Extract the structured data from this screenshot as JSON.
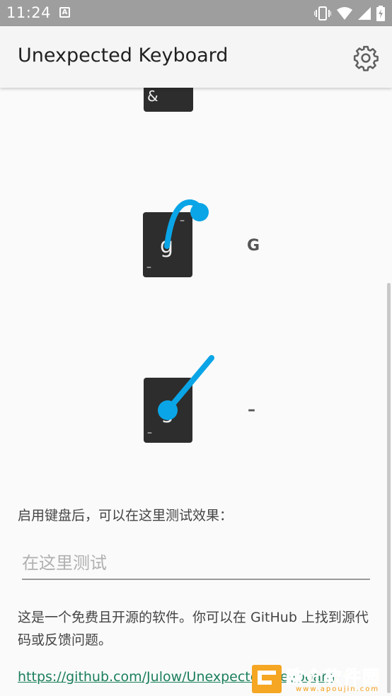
{
  "status_bar": {
    "time": "11:24",
    "notification_letter": "A"
  },
  "app_bar": {
    "title": "Unexpected Keyboard"
  },
  "demo": {
    "key1": {
      "main": "&"
    },
    "key2": {
      "main": "g",
      "corner_top": "–",
      "corner_bottom": "–",
      "result": "G"
    },
    "key3": {
      "main": "g",
      "corner_bottom": "–",
      "result": "–"
    },
    "swipe_color": "#0aa5e6"
  },
  "intro_text": "启用键盘后，可以在这里测试效果：",
  "test_field": {
    "placeholder": "在这里测试",
    "value": ""
  },
  "about_text": "这是一个免费且开源的软件。你可以在 GitHub 上找到源代码或反馈问题。",
  "repo_link": "https://github.com/Julow/Unexpected-Keyboard",
  "watermark": {
    "text": "欧介软件园",
    "sub": "www.apoujin.com"
  }
}
